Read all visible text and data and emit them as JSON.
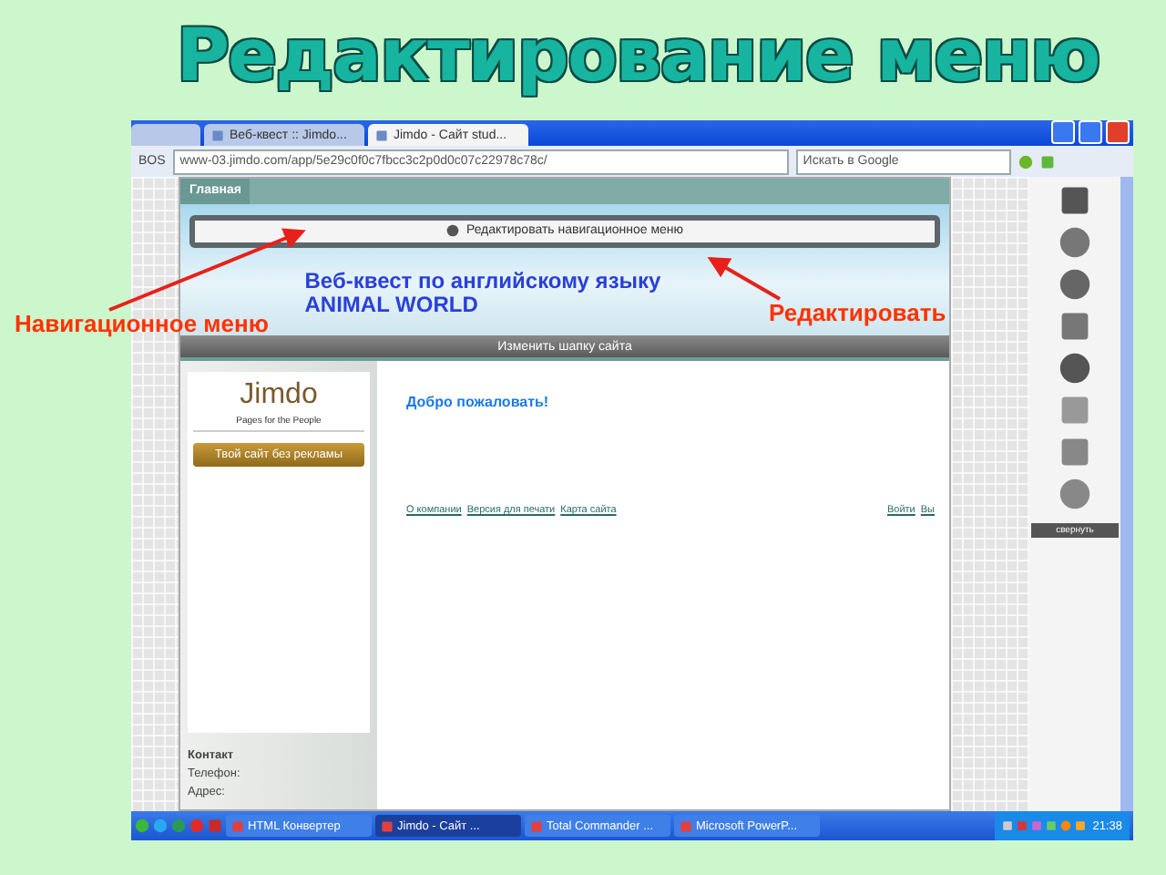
{
  "slide": {
    "title": "Редактирование меню",
    "annotations": [
      {
        "text": "Навигационное меню",
        "kind": "left"
      },
      {
        "text": "Редактировать",
        "kind": "right"
      }
    ]
  },
  "browser": {
    "tabs": [
      {
        "label": "Веб-квест :: Jimdo...",
        "selected": false
      },
      {
        "label": "Jimdo - Сайт stud...",
        "selected": true
      }
    ],
    "home": "BOS",
    "address": "www-03.jimdo.com/app/5e29c0f0c7fbcc3c2p0d0c07c22978c78c/",
    "search_placeholder": "Искать в Google"
  },
  "site": {
    "nav": [
      {
        "label": "Главная",
        "selected": true
      }
    ],
    "edit_bar": "Редактировать навигационное меню",
    "header_title": [
      "Веб-квест по английскому языку",
      "ANIMAL WORLD"
    ],
    "header_button": "Изменить шапку сайта",
    "logo": "Jimdo",
    "tagline": "Pages for the People",
    "ad_button": "Твой сайт без рекламы",
    "contact_heading": "Контакт",
    "contact_lines": [
      "Телефон:",
      "Адрес:"
    ],
    "welcome": "Добро пожаловать!",
    "footer_links": [
      "О компании",
      "Версия для печати",
      "Карта сайта"
    ],
    "footer_right": [
      "Войти",
      "Вы"
    ]
  },
  "editor_panel": {
    "collapse": "свернуть"
  },
  "taskbar": {
    "items": [
      {
        "label": "HTML Конвертер",
        "selected": false
      },
      {
        "label": "Jimdo - Сайт ...",
        "selected": true
      },
      {
        "label": "Total Commander ...",
        "selected": false
      },
      {
        "label": "Microsoft PowerP...",
        "selected": false
      }
    ],
    "clock": "21:38"
  }
}
